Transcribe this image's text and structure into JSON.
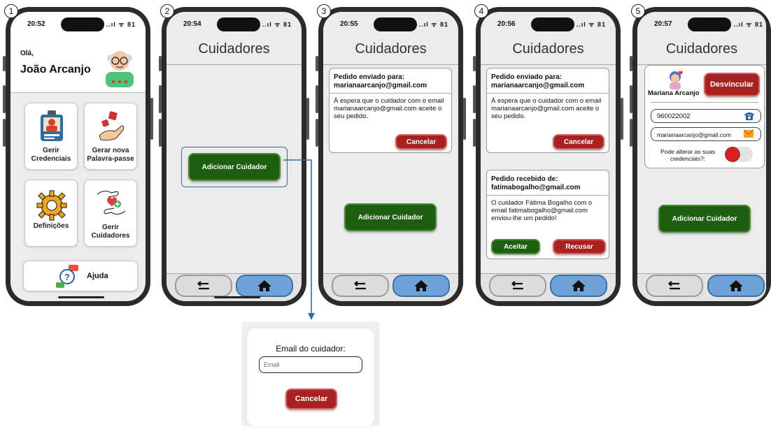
{
  "screens": [
    {
      "step": "1",
      "time": "20:52",
      "signal": "..ıl ᯤ 81",
      "greeting": "Olá,",
      "user_name": "João Arcanjo",
      "tiles": [
        "Gerir Credenciais",
        "Gerar nova Palavra-passe",
        "Definições",
        "Gerir Cuidadores"
      ],
      "help_label": "Ajuda"
    },
    {
      "step": "2",
      "time": "20:54",
      "signal": "..ıl ᯤ 81",
      "title": "Cuidadores",
      "add_button": "Adicionar Cuidador"
    },
    {
      "step": "3",
      "time": "20:55",
      "signal": "..ıl ᯤ 81",
      "title": "Cuidadores",
      "sent_card": {
        "header": "Pedido enviado para: marianaarcanjo@gmail.com",
        "body": "À espera que o cuidador com o email marianaarcanjo@gmail.com aceite o seu pedido.",
        "cancel": "Cancelar"
      },
      "add_button": "Adicionar Cuidador"
    },
    {
      "step": "4",
      "time": "20:56",
      "signal": "..ıl ᯤ 81",
      "title": "Cuidadores",
      "sent_card": {
        "header": "Pedido enviado para: marianaarcanjo@gmail.com",
        "body": "À espera que o cuidador com o email marianaarcanjo@gmail.com aceite o seu pedido.",
        "cancel": "Cancelar"
      },
      "received_card": {
        "header": "Pedido recebido de: fatimabogalho@gmail.com",
        "body": "O cuidador Fátima Bogalho com o email fatimabogalho@gmail.com enviou-lhe um pedido!",
        "accept": "Aceitar",
        "reject": "Recusar"
      }
    },
    {
      "step": "5",
      "time": "20:57",
      "signal": "..ıl ᯤ 81",
      "title": "Cuidadores",
      "caregiver": {
        "name": "Mariana Arcanjo",
        "unlink": "Desvincular",
        "phone": "960022002",
        "email": "marianaarcanjo@gmail.com",
        "permission_label": "Pode alterar as suas credenciais?:"
      },
      "add_button": "Adicionar Cuidador"
    }
  ],
  "popup": {
    "label": "Email do cuidador:",
    "placeholder": "Email",
    "cancel": "Cancelar"
  },
  "colors": {
    "green": "#1d5e10",
    "red": "#a82121",
    "home_blue": "#6fa3d8",
    "connector": "#2f6ea6"
  }
}
